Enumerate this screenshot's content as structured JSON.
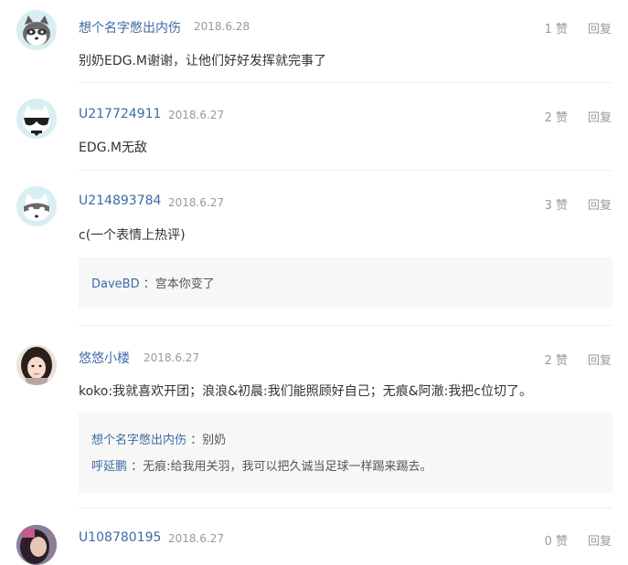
{
  "comments": [
    {
      "user": "想个名字憋出内伤",
      "date": "2018.6.28",
      "likes": "1 赞",
      "reply": "回复",
      "text": "别奶EDG.M谢谢，让他们好好发挥就完事了",
      "avatar_icon": "raccoon-avatar-icon"
    },
    {
      "user": "U217724911",
      "date": "2018.6.27",
      "likes": "2 赞",
      "reply": "回复",
      "text": "EDG.M无敌",
      "avatar_icon": "sunglasses-avatar-icon"
    },
    {
      "user": "U214893784",
      "date": "2018.6.27",
      "likes": "3 赞",
      "reply": "回复",
      "text": "c(一个表情上热评)",
      "avatar_icon": "masked-avatar-icon",
      "sub_replies": [
        {
          "user": "DaveBD",
          "text": "：宫本你变了"
        }
      ]
    },
    {
      "user": "悠悠小楼",
      "date": "2018.6.27",
      "likes": "2 赞",
      "reply": "回复",
      "text": "koko:我就喜欢开团；浪浪&初晨:我们能照顾好自己；无痕&阿澈:我把c位切了。",
      "avatar_icon": "photo-avatar-icon",
      "sub_replies": [
        {
          "user": "想个名字憋出内伤",
          "text": "：别奶"
        },
        {
          "user": "呼延鹏",
          "text": "：无痕:给我用关羽，我可以把久诚当足球一样踢来踢去。"
        }
      ]
    },
    {
      "user": "U108780195",
      "date": "2018.6.27",
      "likes": "0 赞",
      "reply": "回复",
      "avatar_icon": "photo-avatar-icon"
    }
  ],
  "colors": {
    "username": "#3d6aa6",
    "meta": "#999999",
    "body_text": "#333333",
    "reply_box": "#f7f7f7",
    "avatar_bg": "#d9eef0"
  }
}
